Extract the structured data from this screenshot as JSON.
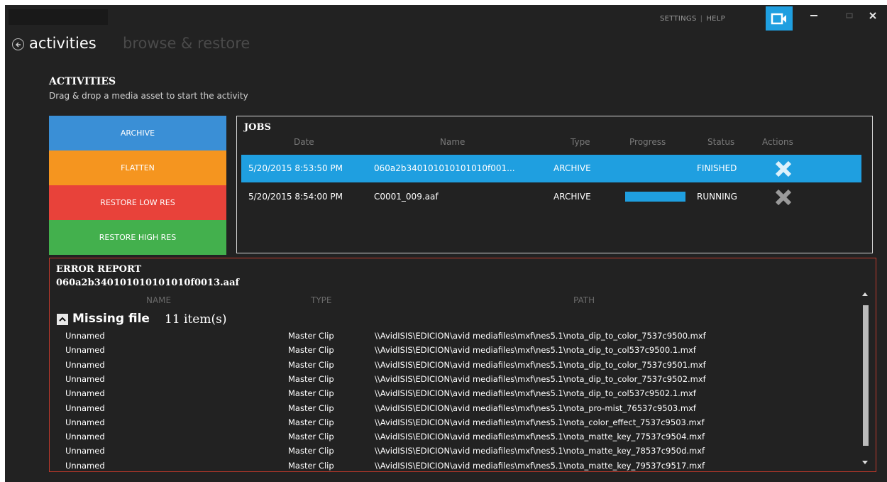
{
  "header": {
    "settings": "SETTINGS",
    "separator": "|",
    "help": "HELP",
    "camera_icon": "video-camera-icon",
    "accent": "#1f9fe0"
  },
  "nav": {
    "back_icon": "back-arrow-icon",
    "active_tab": "activities",
    "inactive_tab": "browse & restore"
  },
  "activities": {
    "title": "ACTIVITIES",
    "subtitle": "Drag & drop a media asset to start the activity",
    "buttons": [
      {
        "label": "ARCHIVE",
        "color": "#3a8fd6"
      },
      {
        "label": "FLATTEN",
        "color": "#f5951f"
      },
      {
        "label": "RESTORE LOW RES",
        "color": "#e8423a"
      },
      {
        "label": "RESTORE HIGH RES",
        "color": "#43b04d"
      }
    ]
  },
  "jobs": {
    "title": "JOBS",
    "columns": [
      "Date",
      "Name",
      "Type",
      "Progress",
      "Status",
      "Actions"
    ],
    "rows": [
      {
        "date": "5/20/2015 8:53:50 PM",
        "name": "060a2b340101010101010f001...",
        "type": "ARCHIVE",
        "progress": 0,
        "status": "FINISHED",
        "action_icon": "close-x-icon",
        "selected": true
      },
      {
        "date": "5/20/2015 8:54:00 PM",
        "name": "C0001_009.aaf",
        "type": "ARCHIVE",
        "progress": 1,
        "status": "RUNNING",
        "action_icon": "close-x-icon",
        "selected": false
      }
    ]
  },
  "error_report": {
    "title": "ERROR REPORT",
    "file": "060a2b340101010101010f0013.aaf",
    "columns": [
      "NAME",
      "TYPE",
      "PATH"
    ],
    "group": {
      "name": "Missing file",
      "count": "11 item(s)",
      "toggle_icon": "chevron-up-icon"
    },
    "rows": [
      {
        "name": "Unnamed",
        "type": "Master Clip",
        "path": "\\\\AvidISIS\\EDICION\\avid mediafiles\\mxf\\nes5.1\\nota_dip_to_color_7537c9500.mxf"
      },
      {
        "name": "Unnamed",
        "type": "Master Clip",
        "path": "\\\\AvidISIS\\EDICION\\avid mediafiles\\mxf\\nes5.1\\nota_dip_to_col537c9500.1.mxf"
      },
      {
        "name": "Unnamed",
        "type": "Master Clip",
        "path": "\\\\AvidISIS\\EDICION\\avid mediafiles\\mxf\\nes5.1\\nota_dip_to_color_7537c9501.mxf"
      },
      {
        "name": "Unnamed",
        "type": "Master Clip",
        "path": "\\\\AvidISIS\\EDICION\\avid mediafiles\\mxf\\nes5.1\\nota_dip_to_color_7537c9502.mxf"
      },
      {
        "name": "Unnamed",
        "type": "Master Clip",
        "path": "\\\\AvidISIS\\EDICION\\avid mediafiles\\mxf\\nes5.1\\nota_dip_to_col537c9502.1.mxf"
      },
      {
        "name": "Unnamed",
        "type": "Master Clip",
        "path": "\\\\AvidISIS\\EDICION\\avid mediafiles\\mxf\\nes5.1\\nota_pro-mist_76537c9503.mxf"
      },
      {
        "name": "Unnamed",
        "type": "Master Clip",
        "path": "\\\\AvidISIS\\EDICION\\avid mediafiles\\mxf\\nes5.1\\nota_color_effect_7537c9503.mxf"
      },
      {
        "name": "Unnamed",
        "type": "Master Clip",
        "path": "\\\\AvidISIS\\EDICION\\avid mediafiles\\mxf\\nes5.1\\nota_matte_key_77537c9504.mxf"
      },
      {
        "name": "Unnamed",
        "type": "Master Clip",
        "path": "\\\\AvidISIS\\EDICION\\avid mediafiles\\mxf\\nes5.1\\nota_matte_key_78537c950d.mxf"
      },
      {
        "name": "Unnamed",
        "type": "Master Clip",
        "path": "\\\\AvidISIS\\EDICION\\avid mediafiles\\mxf\\nes5.1\\nota_matte_key_79537c9517.mxf"
      }
    ]
  }
}
